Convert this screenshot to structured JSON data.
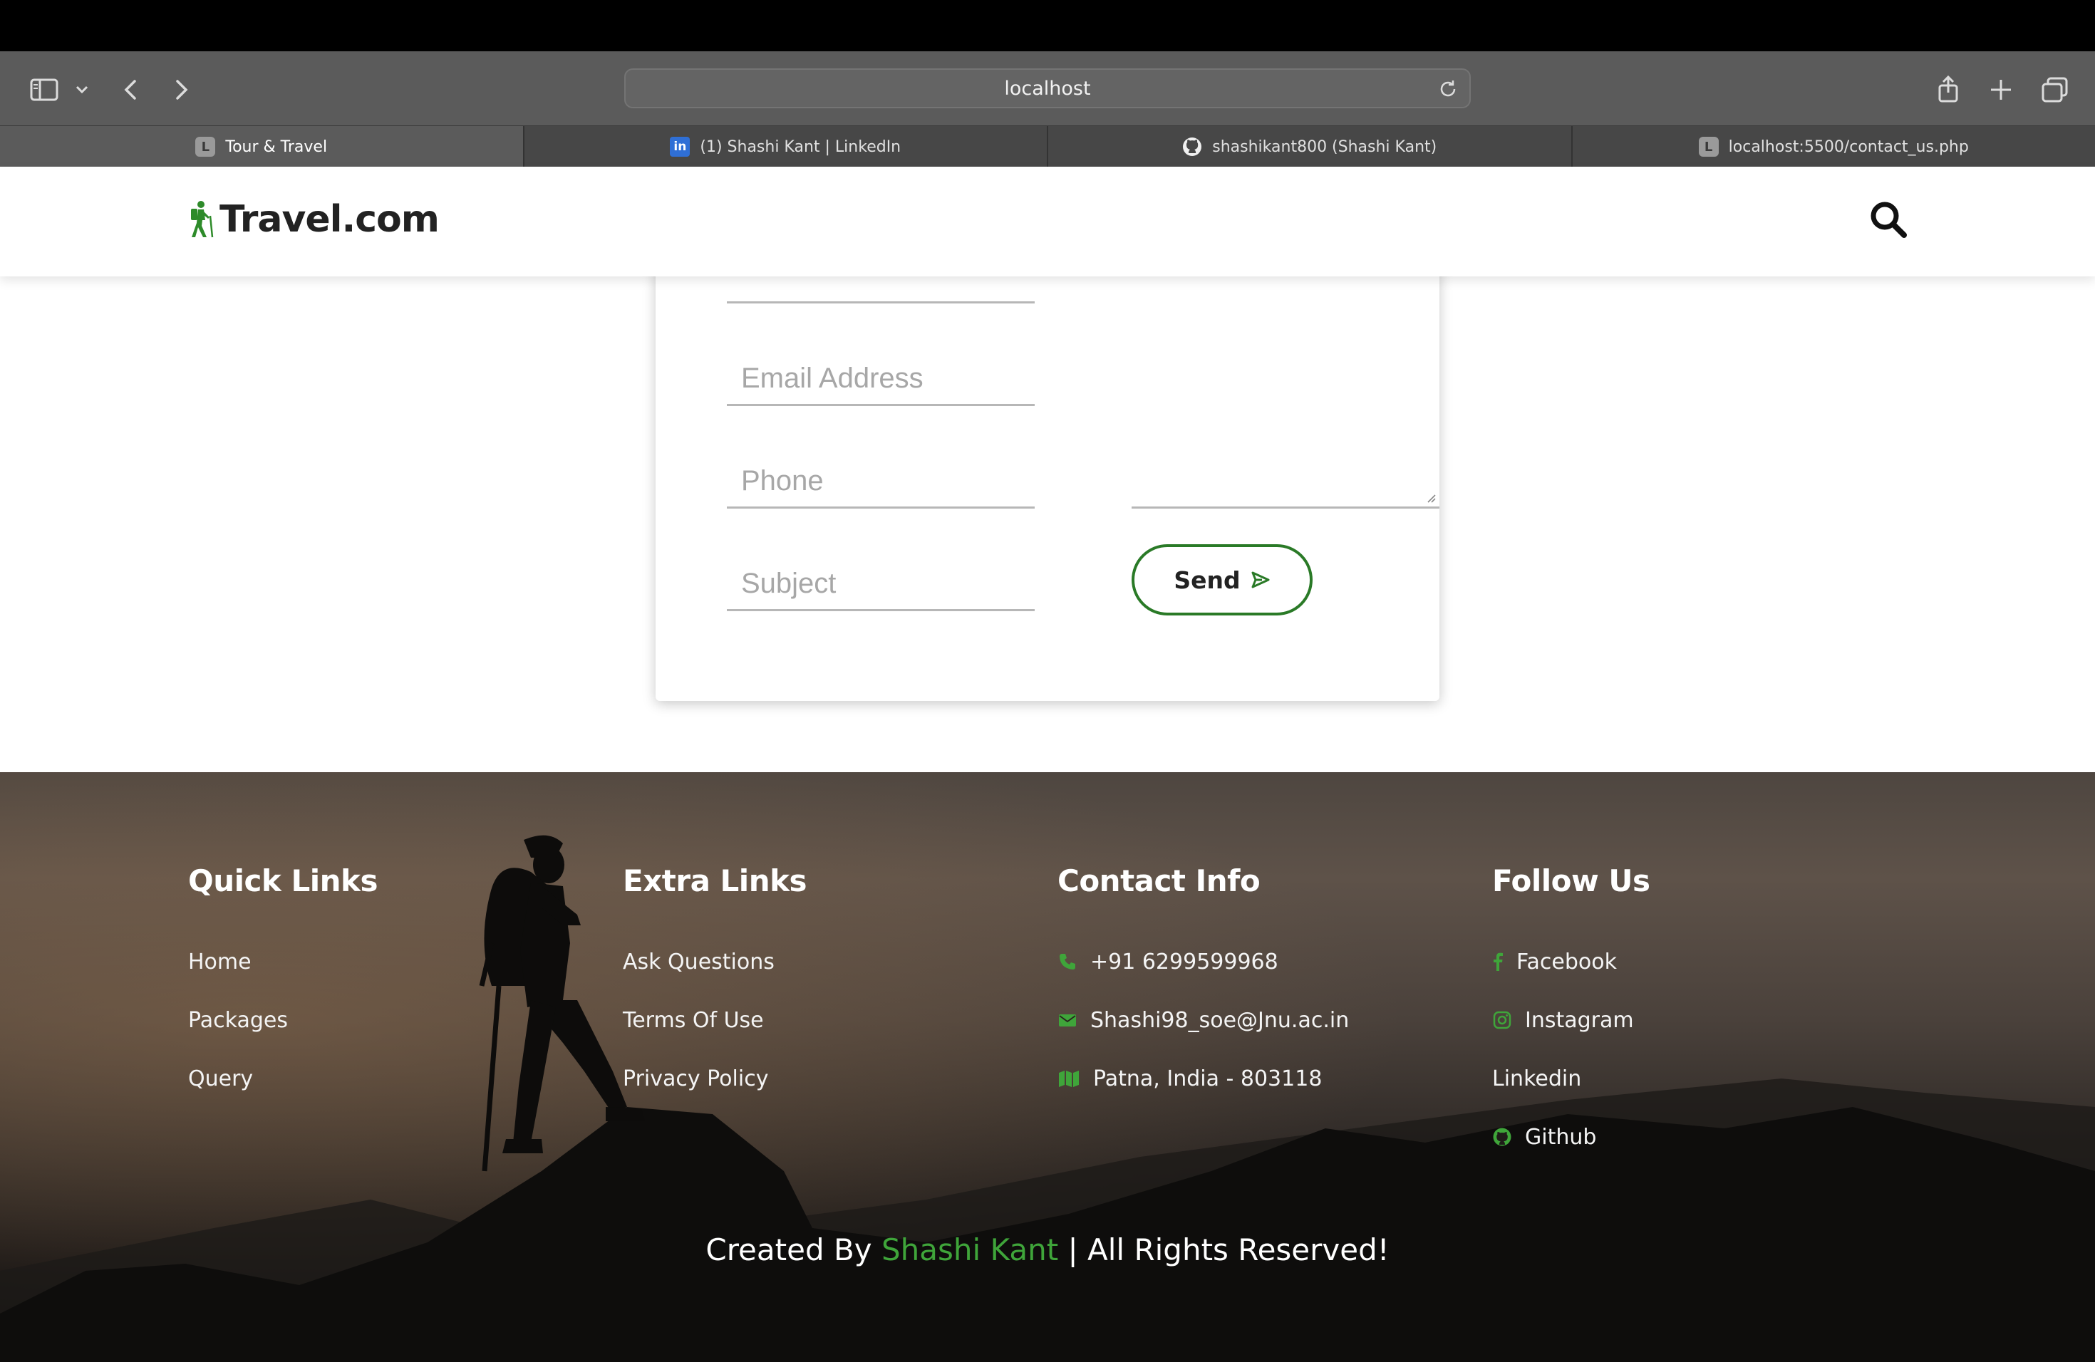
{
  "browser": {
    "url": "localhost",
    "tabs": [
      {
        "label": "Tour & Travel",
        "favicon": "L",
        "active": true
      },
      {
        "label": "(1) Shashi Kant | LinkedIn",
        "favicon": "in",
        "active": false
      },
      {
        "label": "shashikant800 (Shashi Kant)",
        "favicon": "github",
        "active": false
      },
      {
        "label": "localhost:5500/contact_us.php",
        "favicon": "L",
        "active": false
      }
    ]
  },
  "header": {
    "logo_text": "Travel.com"
  },
  "form": {
    "email_placeholder": "Email Address",
    "phone_placeholder": "Phone",
    "subject_placeholder": "Subject",
    "send_label": "Send"
  },
  "footer": {
    "quick_links": {
      "title": "Quick Links",
      "items": [
        "Home",
        "Packages",
        "Query"
      ]
    },
    "extra_links": {
      "title": "Extra Links",
      "items": [
        "Ask Questions",
        "Terms Of Use",
        "Privacy Policy"
      ]
    },
    "contact_info": {
      "title": "Contact Info",
      "phone": "+91 6299599968",
      "email": "Shashi98_soe@Jnu.ac.in",
      "address": "Patna, India - 803118"
    },
    "follow_us": {
      "title": "Follow Us",
      "facebook": "Facebook",
      "instagram": "Instagram",
      "linkedin": "Linkedin",
      "github": "Github"
    },
    "credit": {
      "prefix": "Created By",
      "name": "Shashi Kant",
      "suffix": "| All Rights Reserved!"
    }
  },
  "colors": {
    "accent": "#3fa53a",
    "button_border": "#2a7a27"
  }
}
